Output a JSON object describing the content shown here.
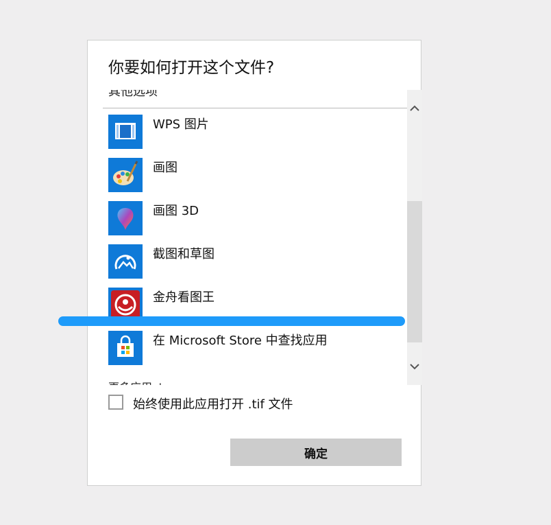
{
  "dialog": {
    "title": "你要如何打开这个文件?",
    "section_header": "其他选项",
    "apps": [
      {
        "label": "WPS 图片",
        "icon": "wps-picture-icon"
      },
      {
        "label": "画图",
        "icon": "paint-palette-icon"
      },
      {
        "label": "画图 3D",
        "icon": "paint-3d-icon"
      },
      {
        "label": "截图和草图",
        "icon": "snip-sketch-icon"
      },
      {
        "label": "金舟看图王",
        "icon": "jinzhou-viewer-icon"
      },
      {
        "label": "在 Microsoft Store 中查找应用",
        "icon": "microsoft-store-icon"
      }
    ],
    "more_apps": "更多应用 ↓",
    "always_use_label": "始终使用此应用打开 .tif 文件",
    "always_use_checked": false,
    "ok_label": "确定"
  },
  "colors": {
    "accent": "#0f7ad8",
    "highlight": "#1e9bfa",
    "button_bg": "#cccccc"
  }
}
